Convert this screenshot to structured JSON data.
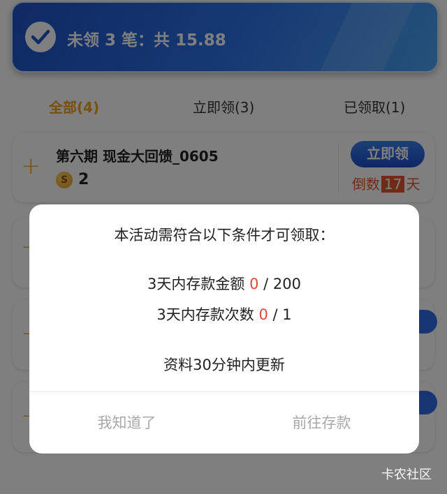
{
  "banner": {
    "text": "未领 3 笔：共 15.88",
    "icon": "check-circle-icon"
  },
  "tabs": [
    {
      "label": "全部(4)",
      "active": true
    },
    {
      "label": "立即领(3)",
      "active": false
    },
    {
      "label": "已领取(1)",
      "active": false
    }
  ],
  "card": {
    "title": "第六期 现金大回馈_0605",
    "coin_symbol": "S",
    "amount": "2",
    "claim_label": "立即领",
    "countdown_prefix": "倒数",
    "countdown_days": "17",
    "countdown_suffix": "天"
  },
  "modal": {
    "title": "本活动需符合以下条件才可领取：",
    "conditions": [
      {
        "label": "3天内存款金额",
        "current": "0",
        "target": "/ 200"
      },
      {
        "label": "3天内存款次数",
        "current": "0",
        "target": "/ 1"
      }
    ],
    "note": "资料30分钟内更新",
    "cancel_label": "我知道了",
    "confirm_label": "前往存款"
  },
  "watermark": "卡农社区",
  "colors": {
    "accent_blue": "#1d4fc9",
    "tab_active": "#f0a020",
    "highlight_red": "#e3483a"
  }
}
